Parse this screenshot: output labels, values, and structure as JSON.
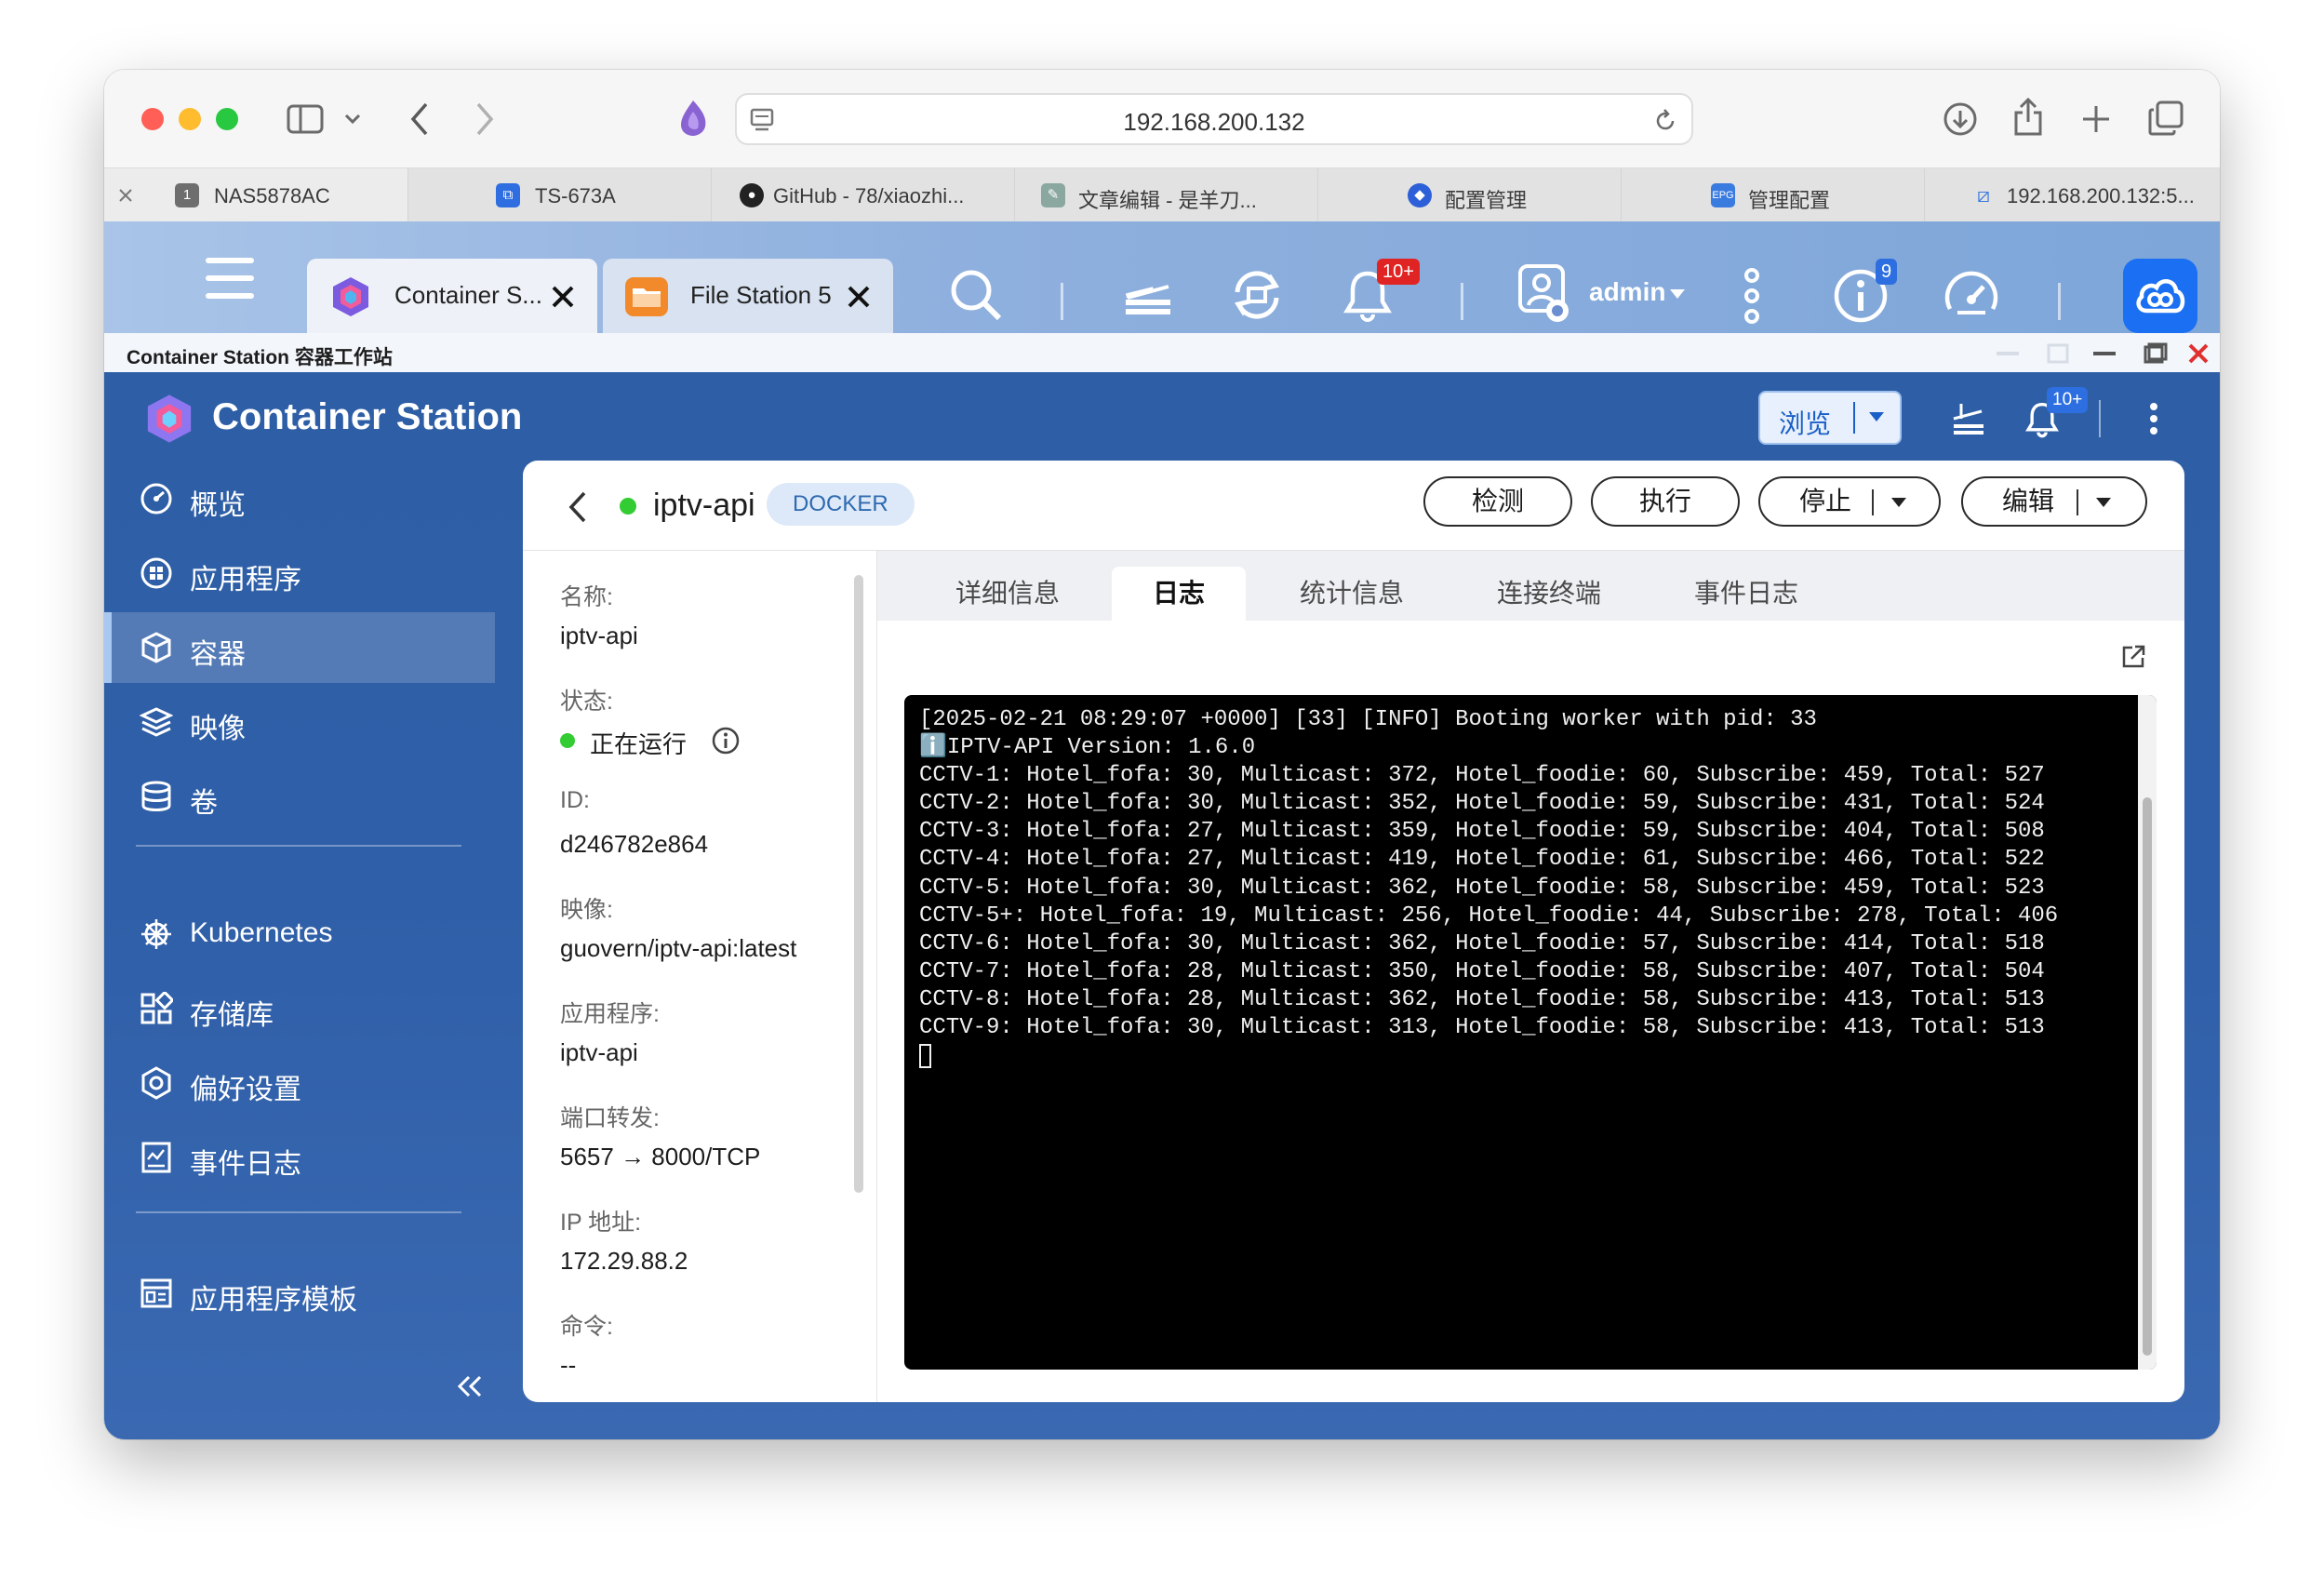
{
  "browser": {
    "url": "192.168.200.132",
    "tabs": [
      {
        "label": "NAS5878AC",
        "favicon_text": "1",
        "favicon_color": "#6e6e6e"
      },
      {
        "label": "TS-673A",
        "favicon_color": "#2f6ee0"
      },
      {
        "label": "GitHub - 78/xiaozhi...",
        "favicon_color": "#222222"
      },
      {
        "label": "文章编辑 - 是羊刀...",
        "favicon_color": "#8aa8a0"
      },
      {
        "label": "配置管理",
        "favicon_color": "#2d5fd8"
      },
      {
        "label": "管理配置",
        "favicon_text": "EPG",
        "favicon_color": "#3a7be0"
      },
      {
        "label": "192.168.200.132:5...",
        "favicon_color": "#3a7be0"
      }
    ]
  },
  "qts": {
    "open_apps": [
      {
        "label": "Container S..."
      },
      {
        "label": "File Station 5"
      }
    ],
    "notification_badge": "10+",
    "user": "admin",
    "info_badge": "9",
    "window_title": "Container Station 容器工作站"
  },
  "app": {
    "title": "Container Station",
    "browse_button": "浏览",
    "notification_badge": "10+",
    "sidebar": {
      "items": [
        {
          "label": "概览",
          "icon": "gauge-icon"
        },
        {
          "label": "应用程序",
          "icon": "apps-icon"
        },
        {
          "label": "容器",
          "icon": "cube-icon",
          "active": true
        },
        {
          "label": "映像",
          "icon": "layers-icon"
        },
        {
          "label": "卷",
          "icon": "database-icon"
        },
        {
          "label": "Kubernetes",
          "icon": "helm-icon"
        },
        {
          "label": "存储库",
          "icon": "grid-icon"
        },
        {
          "label": "偏好设置",
          "icon": "settings-icon"
        },
        {
          "label": "事件日志",
          "icon": "log-icon"
        },
        {
          "label": "应用程序模板",
          "icon": "template-icon"
        }
      ]
    }
  },
  "container": {
    "name": "iptv-api",
    "type_badge": "DOCKER",
    "status_color": "#33cc33",
    "actions": {
      "inspect": "检测",
      "execute": "执行",
      "stop": "停止",
      "edit": "编辑"
    },
    "info": {
      "name_label": "名称:",
      "name_value": "iptv-api",
      "status_label": "状态:",
      "status_value": "正在运行",
      "id_label": "ID:",
      "id_value": "d246782e864",
      "image_label": "映像:",
      "image_value": "guovern/iptv-api:latest",
      "app_label": "应用程序:",
      "app_value": "iptv-api",
      "port_label": "端口转发:",
      "port_value": "5657 → 8000/TCP",
      "ip_label": "IP 地址:",
      "ip_value": "172.29.88.2",
      "cmd_label": "命令:",
      "cmd_value": "--"
    },
    "detail_tabs": [
      "详细信息",
      "日志",
      "统计信息",
      "连接终端",
      "事件日志"
    ],
    "active_tab": "日志",
    "log_lines": [
      "[2025-02-21 08:29:07 +0000] [33] [INFO] Booting worker with pid: 33",
      "ℹ️IPTV-API Version: 1.6.0",
      "CCTV-1: Hotel_fofa: 30, Multicast: 372, Hotel_foodie: 60, Subscribe: 459, Total: 527",
      "CCTV-2: Hotel_fofa: 30, Multicast: 352, Hotel_foodie: 59, Subscribe: 431, Total: 524",
      "CCTV-3: Hotel_fofa: 27, Multicast: 359, Hotel_foodie: 59, Subscribe: 404, Total: 508",
      "CCTV-4: Hotel_fofa: 27, Multicast: 419, Hotel_foodie: 61, Subscribe: 466, Total: 522",
      "CCTV-5: Hotel_fofa: 30, Multicast: 362, Hotel_foodie: 58, Subscribe: 459, Total: 523",
      "CCTV-5+: Hotel_fofa: 19, Multicast: 256, Hotel_foodie: 44, Subscribe: 278, Total: 406",
      "CCTV-6: Hotel_fofa: 30, Multicast: 362, Hotel_foodie: 57, Subscribe: 414, Total: 518",
      "CCTV-7: Hotel_fofa: 28, Multicast: 350, Hotel_foodie: 58, Subscribe: 407, Total: 504",
      "CCTV-8: Hotel_fofa: 28, Multicast: 362, Hotel_foodie: 58, Subscribe: 413, Total: 513",
      "CCTV-9: Hotel_fofa: 30, Multicast: 313, Hotel_foodie: 58, Subscribe: 413, Total: 513"
    ]
  }
}
